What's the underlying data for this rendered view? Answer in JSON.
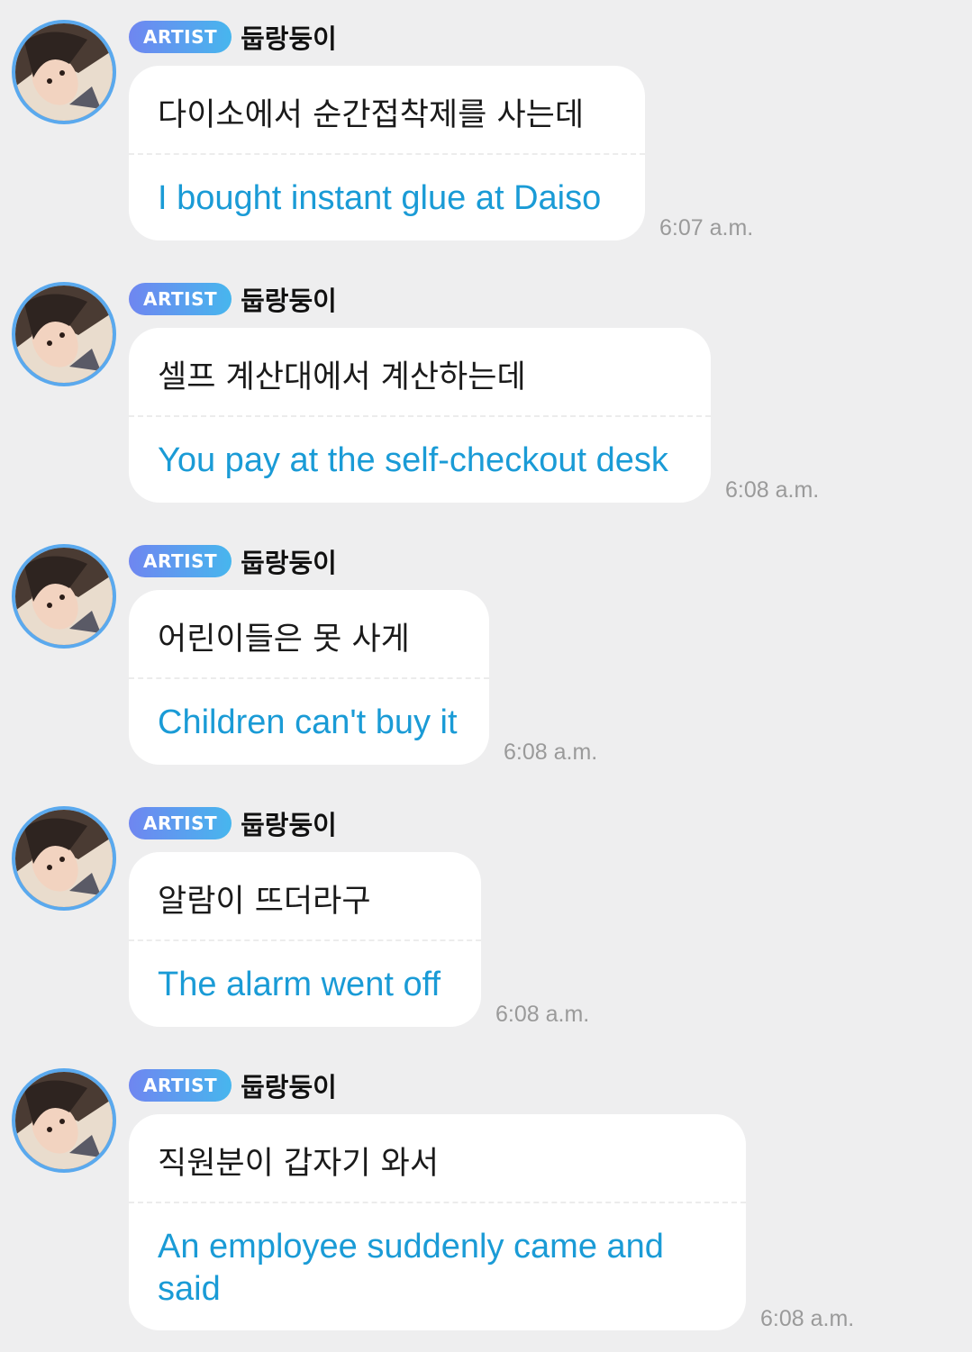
{
  "badge_label": "ARTIST",
  "messages": [
    {
      "sender": "둡랑둥이",
      "korean": "다이소에서 순간접착제를 사는데",
      "english": "I bought instant glue at Daiso",
      "time": "6:07 a.m."
    },
    {
      "sender": "둡랑둥이",
      "korean": "셀프 계산대에서 계산하는데",
      "english": "You pay at the self-checkout desk",
      "time": "6:08 a.m."
    },
    {
      "sender": "둡랑둥이",
      "korean": "어린이들은 못 사게",
      "english": "Children can't buy it",
      "time": "6:08 a.m."
    },
    {
      "sender": "둡랑둥이",
      "korean": "알람이 뜨더라구",
      "english": "The alarm went off",
      "time": "6:08 a.m."
    },
    {
      "sender": "둡랑둥이",
      "korean": "직원분이 갑자기 와서",
      "english": "An employee suddenly came and said",
      "time": "6:08 a.m."
    }
  ],
  "colors": {
    "background": "#eeeeef",
    "bubble": "#ffffff",
    "translation_text": "#1a9bd6",
    "timestamp": "#9a9a9a",
    "avatar_ring": "#5aa9ee",
    "badge_gradient": [
      "#6f86f0",
      "#47b6ee"
    ]
  }
}
